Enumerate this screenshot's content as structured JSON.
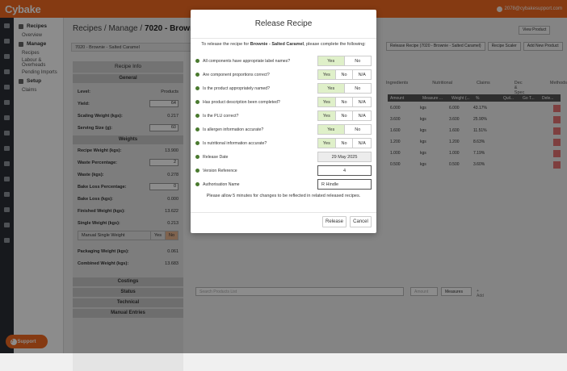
{
  "header": {
    "logo": "Cybake",
    "user": "2078@cybakesupport.com"
  },
  "sidenav": {
    "recipes": "Recipes",
    "overview": "Overview",
    "manage": "Manage",
    "manage_items": [
      "Recipes",
      "Labour & Overheads",
      "Pending Imports"
    ],
    "setup": "Setup",
    "claims": "Claims"
  },
  "page": {
    "title_prefix": "Recipes / Manage /",
    "title_bold": "7020 - Browni",
    "subtitle": "7020 - Brownie - Salted Caramel"
  },
  "recipe_info": {
    "header": "Recipe Info",
    "general": "General",
    "level_label": "Level:",
    "level_value": "Products",
    "yield_label": "Yield:",
    "yield_value": "64",
    "scaling_label": "Scaling Weight (kgs):",
    "scaling_value": "0.217",
    "serving_label": "Serving Size (g):",
    "serving_value": "60",
    "weights": "Weights",
    "recipe_weight_label": "Recipe Weight (kgs):",
    "recipe_weight_value": "13.900",
    "waste_pct_label": "Waste Percentage:",
    "waste_pct_value": "2",
    "waste_label": "Waste (kgs):",
    "waste_value": "0.278",
    "bake_loss_pct_label": "Bake Loss Percentage:",
    "bake_loss_pct_value": "0",
    "bake_loss_label": "Bake Loss (kgs):",
    "bake_loss_value": "0.000",
    "finished_label": "Finished Weight (kgs):",
    "finished_value": "13.622",
    "single_label": "Single Weight (kgs):",
    "single_value": "0.213",
    "manual_label": "Manual Single Weight",
    "manual_yes": "Yes",
    "manual_no": "No",
    "packaging_label": "Packaging Weight (kgs):",
    "packaging_value": "0.061",
    "combined_label": "Combined Weight (kgs):",
    "combined_value": "13.683",
    "sections": [
      "Costings",
      "Status",
      "Technical",
      "Manual Entries"
    ]
  },
  "toolbar": {
    "view_product": "View Product",
    "release": "Release Recipe (7020 - Brownie - Salted Caramel)",
    "recipe_scaler": "Recipe Scaler",
    "add_new": "Add New Product"
  },
  "tabs": [
    "Ingredients",
    "Nutritional",
    "Claims",
    "Dec & Spec",
    "Methods"
  ],
  "table": {
    "headers": [
      "Amount",
      "Measure ...",
      "Weight (...",
      "%",
      "Quil...",
      "Go T...",
      "Dele..."
    ],
    "rows": [
      {
        "amount": "6.000",
        "measure": "kgs",
        "weight": "6.000",
        "pct": "43.17%"
      },
      {
        "amount": "3.600",
        "measure": "kgs",
        "weight": "3.600",
        "pct": "25.90%"
      },
      {
        "amount": "1.600",
        "measure": "kgs",
        "weight": "1.600",
        "pct": "11.51%"
      },
      {
        "amount": "1.200",
        "measure": "kgs",
        "weight": "1.200",
        "pct": "8.63%"
      },
      {
        "amount": "1.000",
        "measure": "kgs",
        "weight": "1.000",
        "pct": "7.19%"
      },
      {
        "amount": "0.500",
        "measure": "kgs",
        "weight": "0.500",
        "pct": "3.60%"
      }
    ]
  },
  "search": {
    "placeholder": "Search Products List",
    "amount_placeholder": "Amount",
    "measures": "Measures",
    "add": "+ Add"
  },
  "support": "Support",
  "modal": {
    "title": "Release Recipe",
    "intro_pre": "To release the recipe for",
    "intro_bold": "Brownie - Salted Caramel",
    "intro_post": ", please complete the following:",
    "questions": [
      {
        "label": "All components have appropriate label names?",
        "opts": [
          "Yes",
          "No"
        ],
        "selected": 0
      },
      {
        "label": "Are component proportions correct?",
        "opts": [
          "Yes",
          "No",
          "N/A"
        ],
        "selected": 0
      },
      {
        "label": "Is the product appropriately named?",
        "opts": [
          "Yes",
          "No"
        ],
        "selected": 0
      },
      {
        "label": "Has product description been completed?",
        "opts": [
          "Yes",
          "No",
          "N/A"
        ],
        "selected": 0
      },
      {
        "label": "Is the PLU correct?",
        "opts": [
          "Yes",
          "No",
          "N/A"
        ],
        "selected": 0
      },
      {
        "label": "Is allergen information accurate?",
        "opts": [
          "Yes",
          "No"
        ],
        "selected": 0
      },
      {
        "label": "Is nutritional information accurate?",
        "opts": [
          "Yes",
          "No",
          "N/A"
        ],
        "selected": 0
      }
    ],
    "release_date_label": "Release Date",
    "release_date_value": "29 May 2025",
    "version_label": "Version Reference",
    "version_value": "4",
    "auth_label": "Authorisation Name",
    "auth_value": "R Hindle",
    "note": "Please allow 5 minutes for changes to be reflected in related released recipes.",
    "release_btn": "Release",
    "cancel_btn": "Cancel"
  }
}
